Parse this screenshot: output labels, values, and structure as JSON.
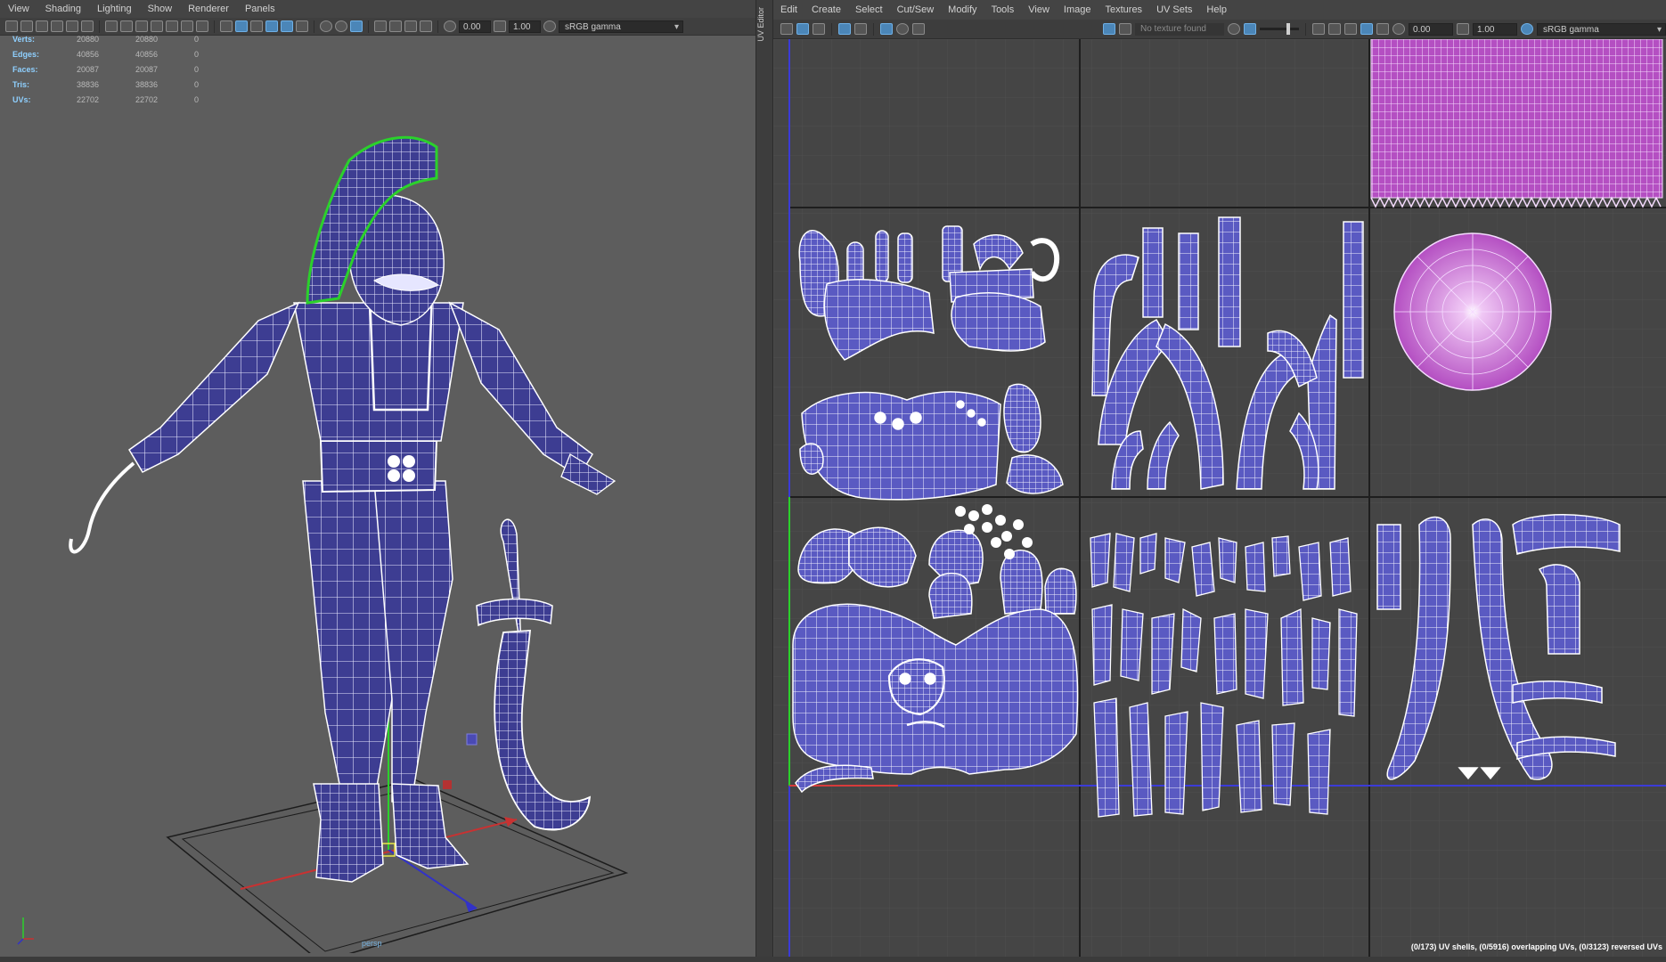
{
  "viewport": {
    "menu": [
      "View",
      "Shading",
      "Lighting",
      "Show",
      "Renderer",
      "Panels"
    ],
    "toolbar": {
      "exposure": "0.00",
      "gamma": "1.00",
      "color_space": "sRGB gamma"
    },
    "hud": [
      {
        "label": "Verts:",
        "v1": "20880",
        "v2": "20880",
        "v3": "0"
      },
      {
        "label": "Edges:",
        "v1": "40856",
        "v2": "40856",
        "v3": "0"
      },
      {
        "label": "Faces:",
        "v1": "20087",
        "v2": "20087",
        "v3": "0"
      },
      {
        "label": "Tris:",
        "v1": "38836",
        "v2": "38836",
        "v3": "0"
      },
      {
        "label": "UVs:",
        "v1": "22702",
        "v2": "22702",
        "v3": "0"
      }
    ],
    "camera": "persp"
  },
  "divider_label": "UV Editor",
  "uv_editor": {
    "menu": [
      "Edit",
      "Create",
      "Select",
      "Cut/Sew",
      "Modify",
      "Tools",
      "View",
      "Image",
      "Textures",
      "UV Sets",
      "Help"
    ],
    "toolbar": {
      "texture": "No texture found",
      "exposure": "0.00",
      "gamma": "1.00",
      "color_space": "sRGB gamma"
    },
    "status": "(0/173) UV shells, (0/5916) overlapping UVs, (0/3123) reversed UVs"
  },
  "colors": {
    "uv_fill": "#5a5ac2",
    "uv_magenta": "#b44fc2",
    "selection": "#2bd12b",
    "hud_label": "#8fd0ff"
  }
}
